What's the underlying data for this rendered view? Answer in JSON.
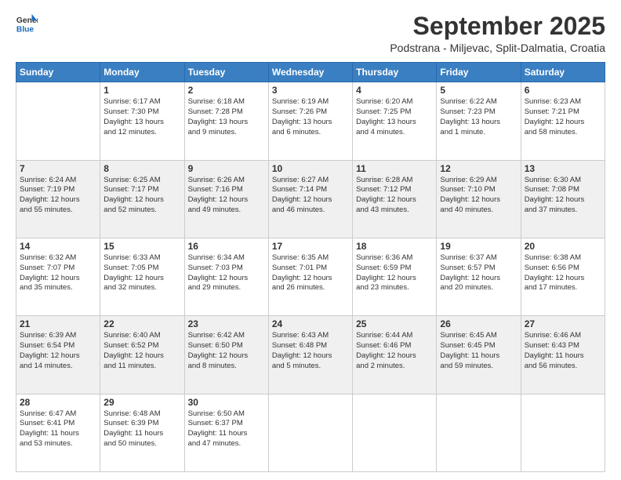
{
  "header": {
    "logo": {
      "general": "General",
      "blue": "Blue"
    },
    "title": "September 2025",
    "location": "Podstrana - Miljevac, Split-Dalmatia, Croatia"
  },
  "calendar": {
    "days_of_week": [
      "Sunday",
      "Monday",
      "Tuesday",
      "Wednesday",
      "Thursday",
      "Friday",
      "Saturday"
    ],
    "weeks": [
      [
        {
          "day": "",
          "info": ""
        },
        {
          "day": "1",
          "info": "Sunrise: 6:17 AM\nSunset: 7:30 PM\nDaylight: 13 hours\nand 12 minutes."
        },
        {
          "day": "2",
          "info": "Sunrise: 6:18 AM\nSunset: 7:28 PM\nDaylight: 13 hours\nand 9 minutes."
        },
        {
          "day": "3",
          "info": "Sunrise: 6:19 AM\nSunset: 7:26 PM\nDaylight: 13 hours\nand 6 minutes."
        },
        {
          "day": "4",
          "info": "Sunrise: 6:20 AM\nSunset: 7:25 PM\nDaylight: 13 hours\nand 4 minutes."
        },
        {
          "day": "5",
          "info": "Sunrise: 6:22 AM\nSunset: 7:23 PM\nDaylight: 13 hours\nand 1 minute."
        },
        {
          "day": "6",
          "info": "Sunrise: 6:23 AM\nSunset: 7:21 PM\nDaylight: 12 hours\nand 58 minutes."
        }
      ],
      [
        {
          "day": "7",
          "info": "Sunrise: 6:24 AM\nSunset: 7:19 PM\nDaylight: 12 hours\nand 55 minutes."
        },
        {
          "day": "8",
          "info": "Sunrise: 6:25 AM\nSunset: 7:17 PM\nDaylight: 12 hours\nand 52 minutes."
        },
        {
          "day": "9",
          "info": "Sunrise: 6:26 AM\nSunset: 7:16 PM\nDaylight: 12 hours\nand 49 minutes."
        },
        {
          "day": "10",
          "info": "Sunrise: 6:27 AM\nSunset: 7:14 PM\nDaylight: 12 hours\nand 46 minutes."
        },
        {
          "day": "11",
          "info": "Sunrise: 6:28 AM\nSunset: 7:12 PM\nDaylight: 12 hours\nand 43 minutes."
        },
        {
          "day": "12",
          "info": "Sunrise: 6:29 AM\nSunset: 7:10 PM\nDaylight: 12 hours\nand 40 minutes."
        },
        {
          "day": "13",
          "info": "Sunrise: 6:30 AM\nSunset: 7:08 PM\nDaylight: 12 hours\nand 37 minutes."
        }
      ],
      [
        {
          "day": "14",
          "info": "Sunrise: 6:32 AM\nSunset: 7:07 PM\nDaylight: 12 hours\nand 35 minutes."
        },
        {
          "day": "15",
          "info": "Sunrise: 6:33 AM\nSunset: 7:05 PM\nDaylight: 12 hours\nand 32 minutes."
        },
        {
          "day": "16",
          "info": "Sunrise: 6:34 AM\nSunset: 7:03 PM\nDaylight: 12 hours\nand 29 minutes."
        },
        {
          "day": "17",
          "info": "Sunrise: 6:35 AM\nSunset: 7:01 PM\nDaylight: 12 hours\nand 26 minutes."
        },
        {
          "day": "18",
          "info": "Sunrise: 6:36 AM\nSunset: 6:59 PM\nDaylight: 12 hours\nand 23 minutes."
        },
        {
          "day": "19",
          "info": "Sunrise: 6:37 AM\nSunset: 6:57 PM\nDaylight: 12 hours\nand 20 minutes."
        },
        {
          "day": "20",
          "info": "Sunrise: 6:38 AM\nSunset: 6:56 PM\nDaylight: 12 hours\nand 17 minutes."
        }
      ],
      [
        {
          "day": "21",
          "info": "Sunrise: 6:39 AM\nSunset: 6:54 PM\nDaylight: 12 hours\nand 14 minutes."
        },
        {
          "day": "22",
          "info": "Sunrise: 6:40 AM\nSunset: 6:52 PM\nDaylight: 12 hours\nand 11 minutes."
        },
        {
          "day": "23",
          "info": "Sunrise: 6:42 AM\nSunset: 6:50 PM\nDaylight: 12 hours\nand 8 minutes."
        },
        {
          "day": "24",
          "info": "Sunrise: 6:43 AM\nSunset: 6:48 PM\nDaylight: 12 hours\nand 5 minutes."
        },
        {
          "day": "25",
          "info": "Sunrise: 6:44 AM\nSunset: 6:46 PM\nDaylight: 12 hours\nand 2 minutes."
        },
        {
          "day": "26",
          "info": "Sunrise: 6:45 AM\nSunset: 6:45 PM\nDaylight: 11 hours\nand 59 minutes."
        },
        {
          "day": "27",
          "info": "Sunrise: 6:46 AM\nSunset: 6:43 PM\nDaylight: 11 hours\nand 56 minutes."
        }
      ],
      [
        {
          "day": "28",
          "info": "Sunrise: 6:47 AM\nSunset: 6:41 PM\nDaylight: 11 hours\nand 53 minutes."
        },
        {
          "day": "29",
          "info": "Sunrise: 6:48 AM\nSunset: 6:39 PM\nDaylight: 11 hours\nand 50 minutes."
        },
        {
          "day": "30",
          "info": "Sunrise: 6:50 AM\nSunset: 6:37 PM\nDaylight: 11 hours\nand 47 minutes."
        },
        {
          "day": "",
          "info": ""
        },
        {
          "day": "",
          "info": ""
        },
        {
          "day": "",
          "info": ""
        },
        {
          "day": "",
          "info": ""
        }
      ]
    ]
  }
}
